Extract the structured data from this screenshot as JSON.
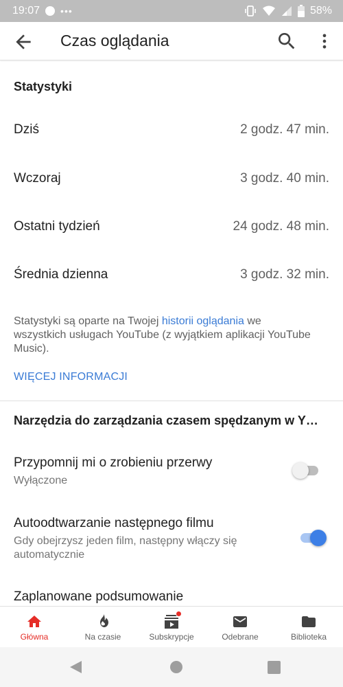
{
  "status_bar": {
    "time": "19:07",
    "dots": "•••",
    "battery": "58%"
  },
  "app_bar": {
    "title": "Czas oglądania",
    "back_icon": "arrow-back-icon",
    "search_icon": "search-icon",
    "more_icon": "more-vert-icon"
  },
  "stats": {
    "title": "Statystyki",
    "rows": [
      {
        "label": "Dziś",
        "value": "2 godz. 47 min."
      },
      {
        "label": "Wczoraj",
        "value": "3 godz. 40 min."
      },
      {
        "label": "Ostatni tydzień",
        "value": "24 godz. 48 min."
      },
      {
        "label": "Średnia dzienna",
        "value": "3 godz. 32 min."
      }
    ],
    "info_before": "Statystyki są oparte na Twojej ",
    "info_link": "historii oglądania",
    "info_after": " we wszystkich usługach YouTube (z wyjątkiem aplikacji YouTube Music).",
    "more_info": "WIĘCEJ INFORMACJI"
  },
  "tools": {
    "title": "Narzędzia do zarządzania czasem spędzanym w Y…",
    "settings": [
      {
        "title": "Przypomnij mi o zrobieniu przerwy",
        "subtitle": "Wyłączone",
        "enabled": false
      },
      {
        "title": "Autoodtwarzanie następnego filmu",
        "subtitle": "Gdy obejrzysz jeden film, następny włączy się automatycznie",
        "enabled": true
      },
      {
        "title": "Zaplanowane podsumowanie"
      }
    ]
  },
  "bottom_nav": {
    "items": [
      {
        "label": "Główna",
        "icon": "home-icon",
        "active": true
      },
      {
        "label": "Na czasie",
        "icon": "flame-icon"
      },
      {
        "label": "Subskrypcje",
        "icon": "subscriptions-icon",
        "badge": true
      },
      {
        "label": "Odebrane",
        "icon": "mail-icon"
      },
      {
        "label": "Biblioteka",
        "icon": "folder-icon"
      }
    ]
  },
  "colors": {
    "accent_red": "#e52d27",
    "link_blue": "#3a7bd5",
    "toggle_on": "#3d7fe6",
    "status_bar": "#bdbdbd"
  }
}
